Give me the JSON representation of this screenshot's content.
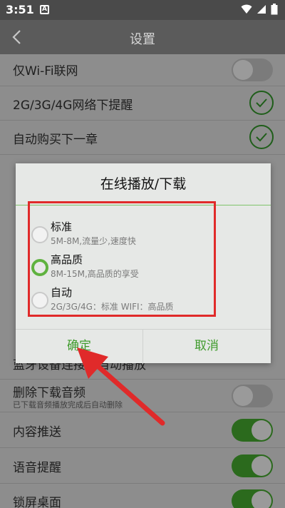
{
  "status_bar": {
    "time": "3:51",
    "notif_letter": "A"
  },
  "app_bar": {
    "title": "设置"
  },
  "settings": [
    {
      "label": "仅Wi-Fi联网",
      "control": "toggle-off"
    },
    {
      "label": "2G/3G/4G网络下提醒",
      "control": "check"
    },
    {
      "label": "自动购买下一章",
      "control": "check"
    },
    {
      "label": "蓝牙设备连接后自动播放",
      "control": "none"
    },
    {
      "label": "删除下载音频",
      "sub": "已下载音频播放完成后自动删除",
      "control": "toggle-off"
    },
    {
      "label": "内容推送",
      "control": "toggle-on"
    },
    {
      "label": "语音提醒",
      "control": "toggle-on"
    },
    {
      "label": "锁屏桌面",
      "control": "toggle-on"
    }
  ],
  "dialog": {
    "title": "在线播放/下载",
    "options": [
      {
        "label": "标准",
        "desc": "5M-8M,流量少,速度快",
        "selected": false
      },
      {
        "label": "高品质",
        "desc": "8M-15M,高品质的享受",
        "selected": true
      },
      {
        "label": "自动",
        "desc": "2G/3G/4G：标准 WIFI：高品质",
        "selected": false
      }
    ],
    "confirm_label": "确定",
    "cancel_label": "取消"
  },
  "colors": {
    "accent": "#3f9b2c",
    "annotation": "#e02a2a"
  }
}
